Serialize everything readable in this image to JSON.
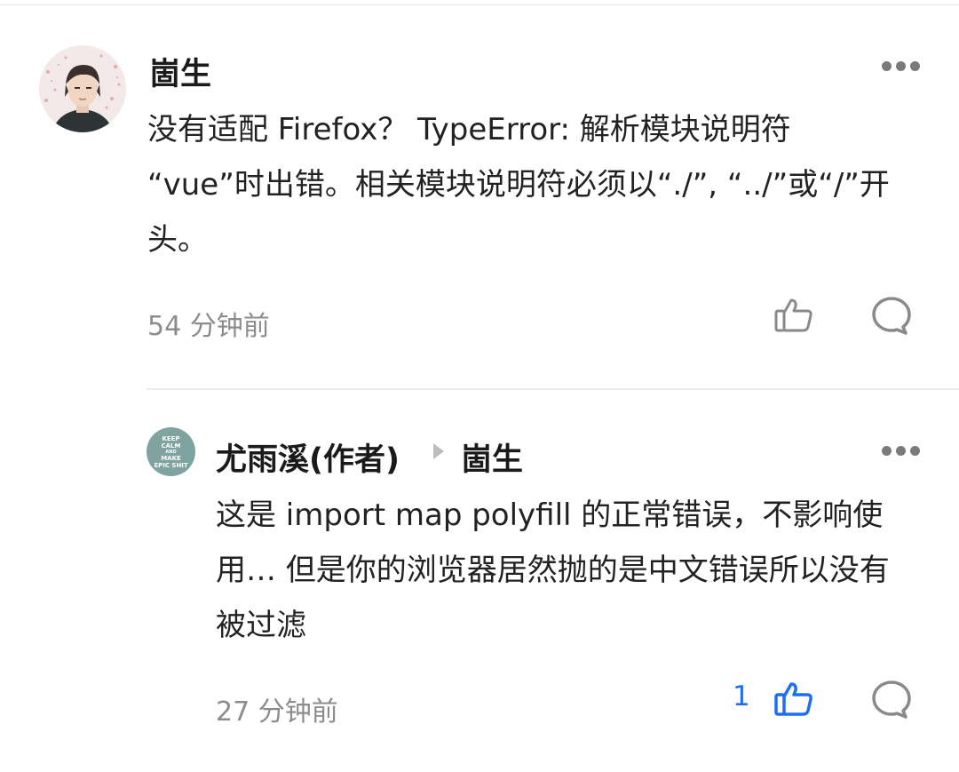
{
  "comments": [
    {
      "author": "崮生",
      "text": "没有适配 Firefox？ TypeError: 解析模块说明符 “vue”时出错。相关模块说明符必须以“./”, “../”或“/”开头。",
      "time": "54 分钟前",
      "avatar_icon": "user-avatar-icon"
    }
  ],
  "reply": {
    "author": "尤雨溪(作者)",
    "reply_to": "崮生",
    "text": "这是 import map polyfill 的正常错误，不影响使用… 但是你的浏览器居然抛的是中文错误所以没有被过滤",
    "time": "27 分钟前",
    "like_count": "1",
    "avatar_text": [
      "KEEP",
      "CALM",
      "AND",
      "MAKE",
      "EPIC SHIT"
    ]
  },
  "colors": {
    "accent_blue": "#1e6ff0",
    "muted_gray": "#8c8c8c",
    "divider": "#ececec"
  }
}
